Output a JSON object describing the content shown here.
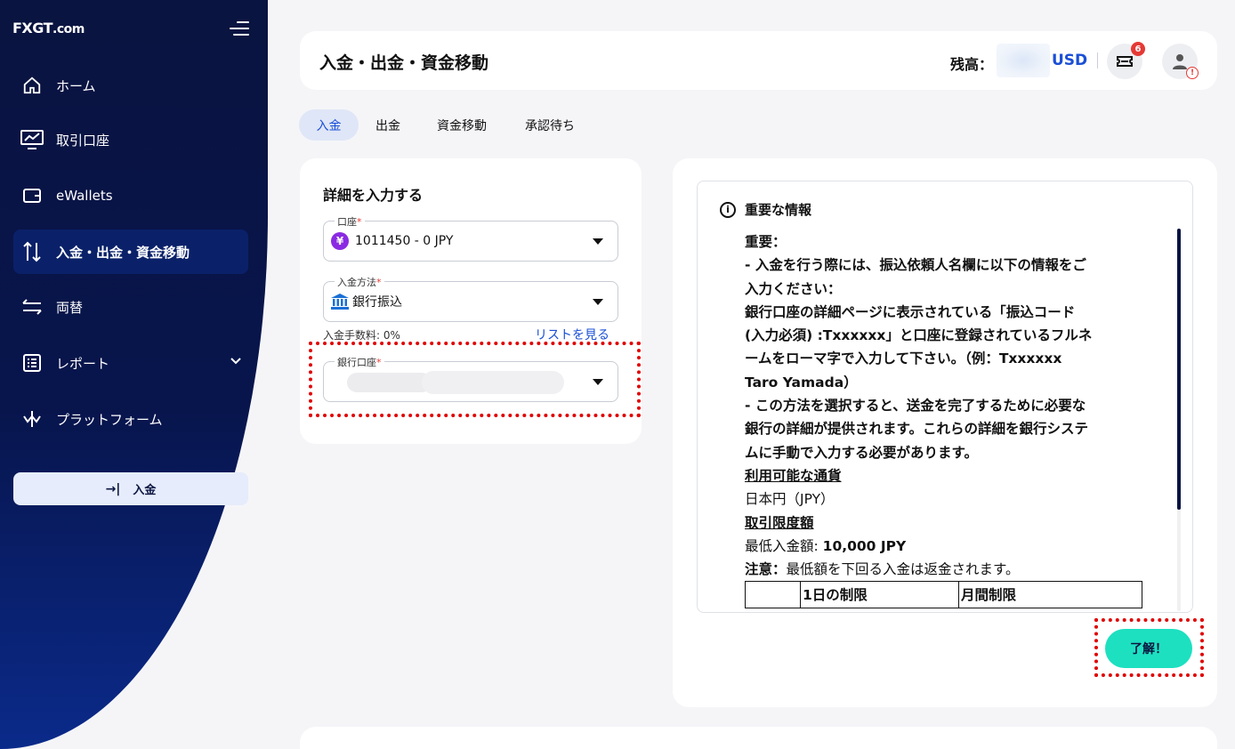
{
  "sidebar": {
    "logo": "FXGT",
    "logo_suffix": ".com",
    "items": [
      {
        "label": "ホーム",
        "icon": "home-icon"
      },
      {
        "label": "取引口座",
        "icon": "chart-monitor-icon"
      },
      {
        "label": "eWallets",
        "icon": "wallet-icon"
      },
      {
        "label": "入金・出金・資金移動",
        "icon": "transfer-arrows-icon"
      },
      {
        "label": "両替",
        "icon": "exchange-icon"
      },
      {
        "label": "レポート",
        "icon": "report-icon"
      },
      {
        "label": "プラットフォーム",
        "icon": "platform-icon"
      }
    ],
    "deposit_button": "入金"
  },
  "header": {
    "title": "入金・出金・資金移動",
    "balance_label": "残高：",
    "balance_currency": "USD",
    "notification_count": "6",
    "avatar_alert": "!"
  },
  "tabs": [
    "入金",
    "出金",
    "資金移動",
    "承認待ち"
  ],
  "form": {
    "title": "詳細を入力する",
    "account_label": "口座",
    "account_value": "1011450 - 0 JPY",
    "method_label": "入金方法",
    "method_value": "銀行振込",
    "fee_label": "入金手数料: 0%",
    "list_link": "リストを見る",
    "bank_label": "銀行口座",
    "required_mark": "*"
  },
  "info": {
    "title": "重要な情報",
    "lines": [
      "重要：",
      "- 入金を行う際には、振込依頼人名欄に以下の情報をご",
      "入力ください：",
      "銀行口座の詳細ページに表示されている「振込コード",
      "(入力必須) :Txxxxxx」と口座に登録されているフルネ",
      "ームをローマ字で入力して下さい。（例：Txxxxxx",
      "Taro Yamada）",
      "- この方法を選択すると、送金を完了するために必要な",
      "銀行の詳細が提供されます。これらの詳細を銀行システ",
      "ムに手動で入力する必要があります。"
    ],
    "currency_heading": "利用可能な通貨",
    "currency_value": "日本円（JPY）",
    "limit_heading": "取引限度額",
    "min_label": "最低入金額: ",
    "min_value": "10,000 JPY",
    "note_label": "注意：",
    "note_value": "最低額を下回る入金は返金されます。",
    "table_headers": [
      "",
      "1日の制限",
      "月間制限"
    ],
    "ok_button": "了解！"
  },
  "colors": {
    "sidebar_bg": "#0a1440",
    "accent_blue": "#1a4fd6",
    "ok_button": "#1de0c0",
    "highlight_red": "#e00000"
  }
}
